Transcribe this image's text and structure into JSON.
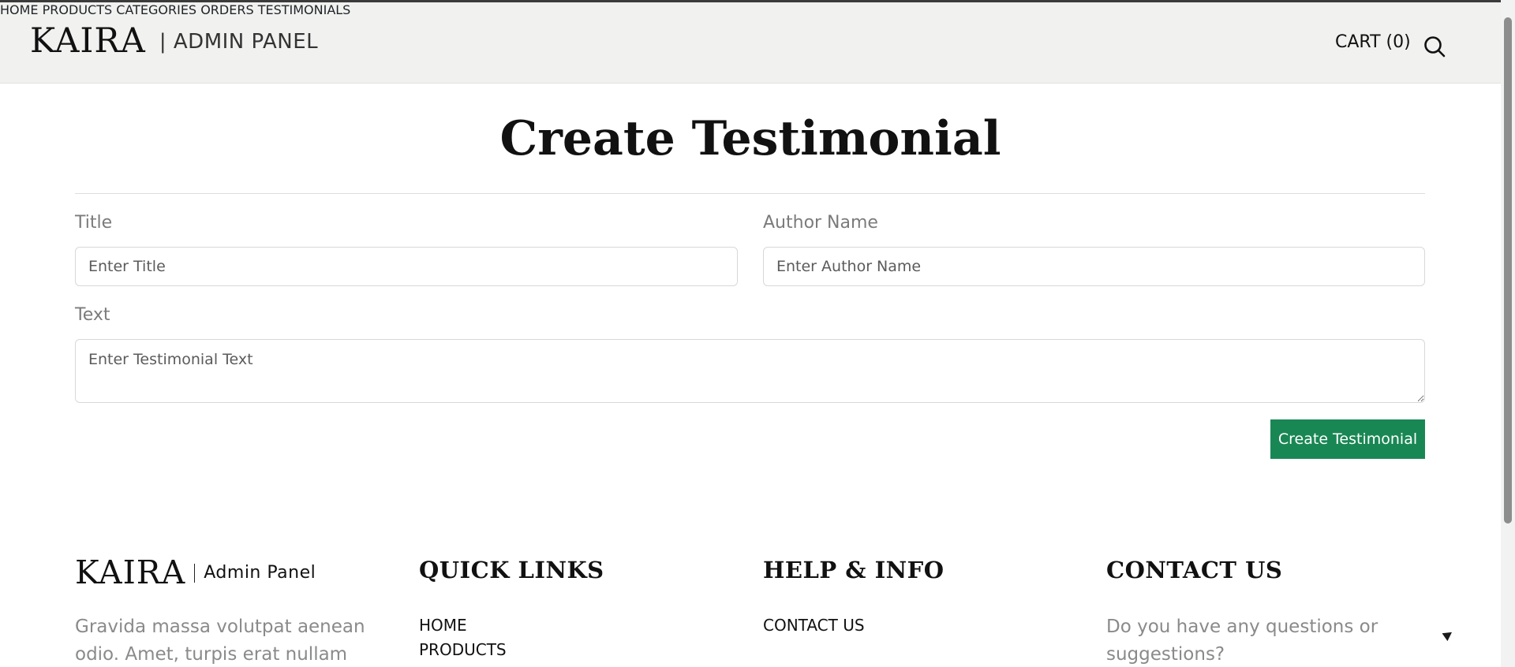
{
  "header": {
    "logo": "KAIRA",
    "subtitle": "| ADMIN PANEL",
    "nav": [
      "HOME",
      "PRODUCTS",
      "CATEGORIES",
      "ORDERS",
      "TESTIMONIALS"
    ],
    "cart": "CART (0)",
    "search_icon": "search-icon"
  },
  "main": {
    "title": "Create Testimonial",
    "form": {
      "title_label": "Title",
      "title_placeholder": "Enter Title",
      "author_label": "Author Name",
      "author_placeholder": "Enter Author Name",
      "text_label": "Text",
      "text_placeholder": "Enter Testimonial Text",
      "submit_label": "Create Testimonial"
    }
  },
  "footer": {
    "logo": "KAIRA",
    "subtitle": "Admin Panel",
    "description": "Gravida massa volutpat aenean odio. Amet, turpis erat nullam fringilla",
    "quick_links": {
      "heading": "QUICK LINKS",
      "items": [
        "HOME",
        "PRODUCTS"
      ]
    },
    "help": {
      "heading": "HELP & INFO",
      "items": [
        "CONTACT US"
      ]
    },
    "contact": {
      "heading": "CONTACT US",
      "text": "Do you have any questions or suggestions?"
    }
  },
  "colors": {
    "header_bg": "#f1f1f0",
    "button_bg": "#198754",
    "muted_text": "#7b7b7b"
  }
}
